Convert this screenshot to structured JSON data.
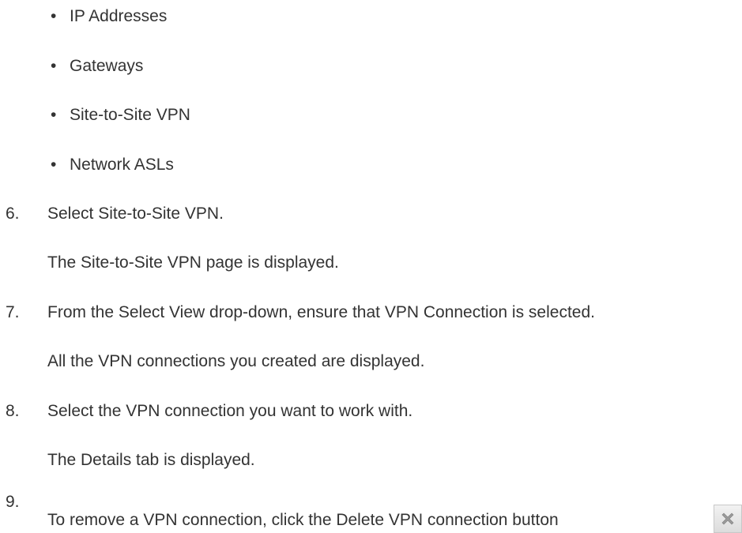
{
  "bullets": [
    "IP Addresses",
    "Gateways",
    "Site-to-Site VPN",
    "Network ASLs"
  ],
  "steps": [
    {
      "number": "6.",
      "instruction": "Select Site-to-Site VPN.",
      "result": "The Site-to-Site VPN page is displayed."
    },
    {
      "number": "7.",
      "instruction": "From the Select View drop-down, ensure that VPN Connection is selected.",
      "result": "All the VPN connections you created are displayed."
    },
    {
      "number": "8.",
      "instruction": "Select the VPN connection you want to work with.",
      "result": "The Details tab is displayed."
    },
    {
      "number": "9.",
      "instruction": "To remove a VPN connection, click the Delete VPN connection button"
    }
  ],
  "icons": {
    "delete": "delete-x-icon"
  }
}
